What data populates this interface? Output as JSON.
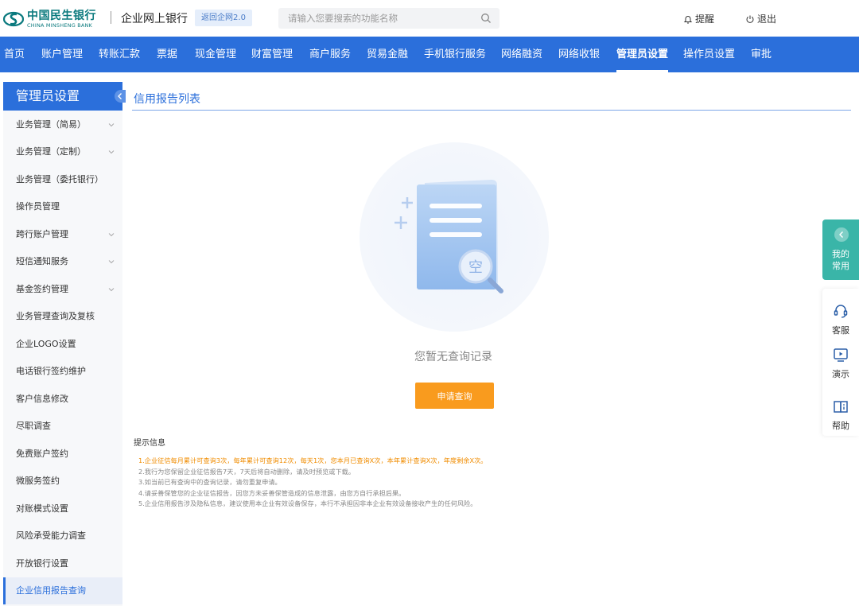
{
  "header": {
    "logo_cn": "中国民生银行",
    "logo_en": "CHINA MINSHENG BANK",
    "app_title": "企业网上银行",
    "return_label": "返回企网2.0",
    "search_placeholder": "请输入您要搜索的功能名称",
    "remind_label": "提醒",
    "logout_label": "退出"
  },
  "nav": {
    "items": [
      "首页",
      "账户管理",
      "转账汇款",
      "票据",
      "现金管理",
      "财富管理",
      "商户服务",
      "贸易金融",
      "手机银行服务",
      "网络融资",
      "网络收银",
      "管理员设置",
      "操作员设置",
      "审批"
    ],
    "active": "管理员设置"
  },
  "sidebar": {
    "title": "管理员设置",
    "items": [
      {
        "label": "业务管理（简易）"
      },
      {
        "label": "业务管理（定制）"
      },
      {
        "label": "业务管理（委托银行）"
      },
      {
        "label": "操作员管理"
      },
      {
        "label": "跨行账户管理"
      },
      {
        "label": "短信通知服务"
      },
      {
        "label": "基金签约管理"
      },
      {
        "label": "业务管理查询及复核"
      },
      {
        "label": "企业LOGO设置"
      },
      {
        "label": "电话银行签约维护"
      },
      {
        "label": "客户信息修改"
      },
      {
        "label": "尽职调查"
      },
      {
        "label": "免费账户签约"
      },
      {
        "label": "微服务签约"
      },
      {
        "label": "对账模式设置"
      },
      {
        "label": "风险承受能力调查"
      },
      {
        "label": "开放银行设置"
      },
      {
        "label": "企业信用报告查询"
      }
    ]
  },
  "main": {
    "title": "信用报告列表",
    "empty_glyph": "空",
    "empty_text": "您暂无查询记录",
    "apply_label": "申请查询",
    "tips_title": "提示信息",
    "tips": [
      "1.企业征信每月累计可查询3次，每年累计可查询12次，每天1次，您本月已查询X次，本年累计查询X次，年度剩余X次。",
      "2.我行为您保留企业征信报告7天，7天后将自动删除，请及时预览或下载。",
      "3.如当前已有查询中的查询记录，请勿重复申请。",
      "4.请妥善保管您的企业征信报告，因您方未妥善保管造成的信息泄露，由您方自行承担后果。",
      "5.企业信用报告涉及隐私信息，建议使用本企业有效设备保存，本行不承担因非本企业有效设备接收产生的任何风险。"
    ]
  },
  "float": {
    "fav_label_1": "我的",
    "fav_label_2": "常用",
    "service_label": "客服",
    "demo_label": "演示",
    "help_label": "帮助"
  },
  "colors": {
    "brand_blue": "#2b6fdb",
    "logo_teal": "#0b7a7e",
    "apply_orange": "#f99b1e",
    "fav_teal": "#3ab5a8"
  }
}
